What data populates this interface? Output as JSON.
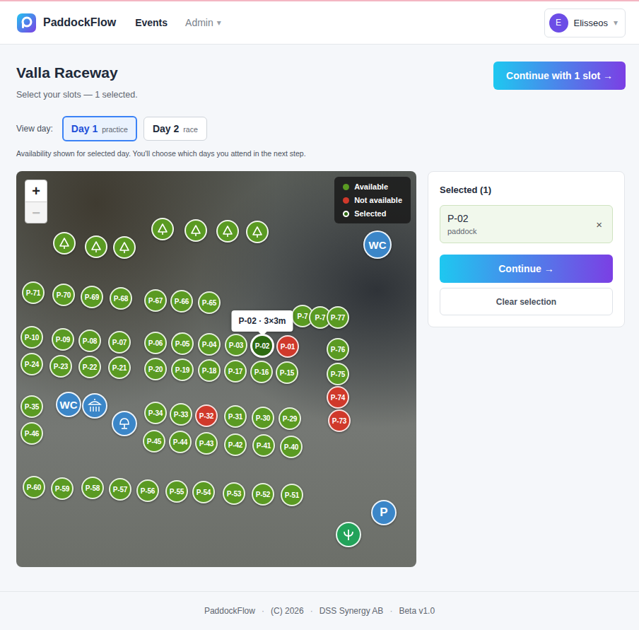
{
  "app": {
    "name": "PaddockFlow"
  },
  "nav": [
    {
      "label": "Events",
      "selected": true,
      "caret": ""
    },
    {
      "label": "Admin",
      "selected": false,
      "caret": "▾"
    }
  ],
  "user": {
    "initial": "E",
    "name": "Elisseos",
    "caret": "▾"
  },
  "page": {
    "title": "Valla Raceway",
    "subtitle": "Select your slots — 1 selected.",
    "cta": "Continue with 1 slot →"
  },
  "day_picker": {
    "label": "View day:",
    "days": [
      {
        "label": "Day 1",
        "sub": "practice",
        "selected": true
      },
      {
        "label": "Day 2",
        "sub": "race",
        "selected": false
      }
    ],
    "note": "Availability shown for selected day. You'll choose which days you attend in the next step."
  },
  "map": {
    "zoom": [
      {
        "label": "+",
        "disabled": false
      },
      {
        "label": "−",
        "disabled": true
      }
    ],
    "legend": [
      {
        "label": "Available",
        "color": "#5a9a22",
        "kind": "dot"
      },
      {
        "label": "Not available",
        "color": "#d0392b",
        "kind": "dot"
      },
      {
        "label": "Selected",
        "color": "#2e6b12",
        "kind": "ring"
      }
    ],
    "tooltip": "P-02 · 3×3m",
    "slots": [
      {
        "label": "P-71",
        "available": true,
        "selected": false
      },
      {
        "label": "P-70",
        "available": true,
        "selected": false
      },
      {
        "label": "P-69",
        "available": true,
        "selected": false
      },
      {
        "label": "P-68",
        "available": true,
        "selected": false
      },
      {
        "label": "P-67",
        "available": true,
        "selected": false
      },
      {
        "label": "P-66",
        "available": true,
        "selected": false
      },
      {
        "label": "P-65",
        "available": true,
        "selected": false
      },
      {
        "label": "P-7",
        "available": true,
        "selected": false
      },
      {
        "label": "P-7",
        "available": true,
        "selected": false
      },
      {
        "label": "P-77",
        "available": true,
        "selected": false
      },
      {
        "label": "P-10",
        "available": true,
        "selected": false
      },
      {
        "label": "P-09",
        "available": true,
        "selected": false
      },
      {
        "label": "P-08",
        "available": true,
        "selected": false
      },
      {
        "label": "P-07",
        "available": true,
        "selected": false
      },
      {
        "label": "P-06",
        "available": true,
        "selected": false
      },
      {
        "label": "P-05",
        "available": true,
        "selected": false
      },
      {
        "label": "P-04",
        "available": true,
        "selected": false
      },
      {
        "label": "P-03",
        "available": true,
        "selected": false
      },
      {
        "label": "P-02",
        "available": true,
        "selected": true
      },
      {
        "label": "P-01",
        "available": false,
        "selected": false
      },
      {
        "label": "P-76",
        "available": true,
        "selected": false
      },
      {
        "label": "P-24",
        "available": true,
        "selected": false
      },
      {
        "label": "P-23",
        "available": true,
        "selected": false
      },
      {
        "label": "P-22",
        "available": true,
        "selected": false
      },
      {
        "label": "P-21",
        "available": true,
        "selected": false
      },
      {
        "label": "P-20",
        "available": true,
        "selected": false
      },
      {
        "label": "P-19",
        "available": true,
        "selected": false
      },
      {
        "label": "P-18",
        "available": true,
        "selected": false
      },
      {
        "label": "P-17",
        "available": true,
        "selected": false
      },
      {
        "label": "P-16",
        "available": true,
        "selected": false
      },
      {
        "label": "P-15",
        "available": true,
        "selected": false
      },
      {
        "label": "P-75",
        "available": true,
        "selected": false
      },
      {
        "label": "P-74",
        "available": false,
        "selected": false
      },
      {
        "label": "P-73",
        "available": false,
        "selected": false
      },
      {
        "label": "P-35",
        "available": true,
        "selected": false
      },
      {
        "label": "P-46",
        "available": true,
        "selected": false
      },
      {
        "label": "P-34",
        "available": true,
        "selected": false
      },
      {
        "label": "P-33",
        "available": true,
        "selected": false
      },
      {
        "label": "P-32",
        "available": false,
        "selected": false
      },
      {
        "label": "P-31",
        "available": true,
        "selected": false
      },
      {
        "label": "P-30",
        "available": true,
        "selected": false
      },
      {
        "label": "P-29",
        "available": true,
        "selected": false
      },
      {
        "label": "P-45",
        "available": true,
        "selected": false
      },
      {
        "label": "P-44",
        "available": true,
        "selected": false
      },
      {
        "label": "P-43",
        "available": true,
        "selected": false
      },
      {
        "label": "P-42",
        "available": true,
        "selected": false
      },
      {
        "label": "P-41",
        "available": true,
        "selected": false
      },
      {
        "label": "P-40",
        "available": true,
        "selected": false
      },
      {
        "label": "P-60",
        "available": true,
        "selected": false
      },
      {
        "label": "P-59",
        "available": true,
        "selected": false
      },
      {
        "label": "P-58",
        "available": true,
        "selected": false
      },
      {
        "label": "P-57",
        "available": true,
        "selected": false
      },
      {
        "label": "P-56",
        "available": true,
        "selected": false
      },
      {
        "label": "P-55",
        "available": true,
        "selected": false
      },
      {
        "label": "P-54",
        "available": true,
        "selected": false
      },
      {
        "label": "P-53",
        "available": true,
        "selected": false
      },
      {
        "label": "P-52",
        "available": true,
        "selected": false
      },
      {
        "label": "P-51",
        "available": true,
        "selected": false
      }
    ],
    "amenities": [
      {
        "kind": "tree",
        "label": ""
      },
      {
        "kind": "tree",
        "label": ""
      },
      {
        "kind": "tree",
        "label": ""
      },
      {
        "kind": "tree",
        "label": ""
      },
      {
        "kind": "tree",
        "label": ""
      },
      {
        "kind": "tree",
        "label": ""
      },
      {
        "kind": "tree",
        "label": ""
      },
      {
        "kind": "wc",
        "label": "WC"
      },
      {
        "kind": "wc",
        "label": "WC"
      },
      {
        "kind": "shower",
        "label": ""
      },
      {
        "kind": "station",
        "label": ""
      },
      {
        "kind": "parking",
        "label": "P"
      },
      {
        "kind": "service",
        "label": ""
      }
    ]
  },
  "selection": {
    "title": "Selected (1)",
    "items": [
      {
        "label": "P-02",
        "type": "paddock",
        "remove": "×"
      }
    ],
    "continue": "Continue →",
    "clear": "Clear selection"
  },
  "footer": {
    "items": [
      "PaddockFlow",
      "(C) 2026",
      "DSS Synergy AB",
      "Beta v1.0"
    ],
    "separator": "·"
  }
}
